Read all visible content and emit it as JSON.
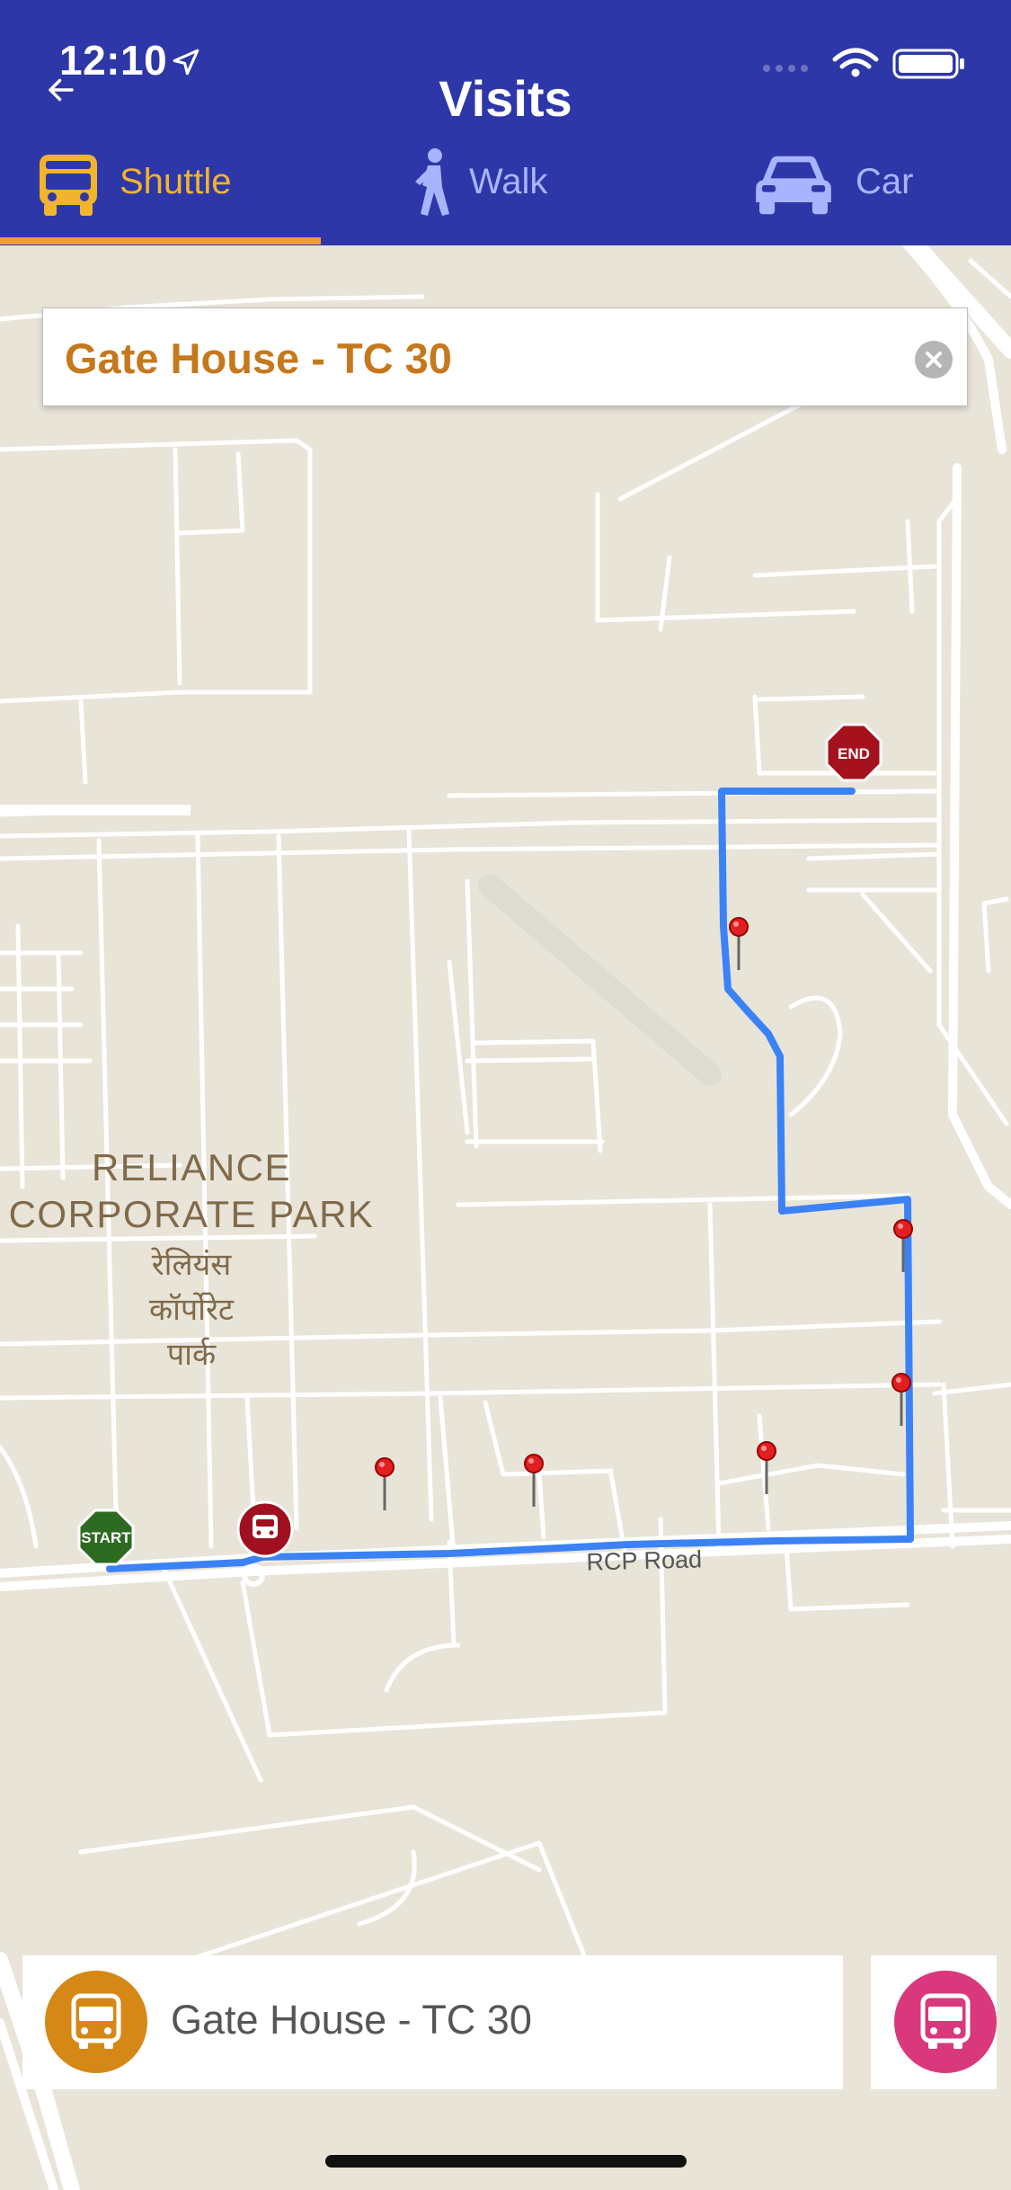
{
  "status": {
    "time": "12:10"
  },
  "header": {
    "title": "Visits"
  },
  "tabs": [
    {
      "label": "Shuttle",
      "selected": true
    },
    {
      "label": "Walk",
      "selected": false
    },
    {
      "label": "Car",
      "selected": false
    }
  ],
  "search": {
    "value": "Gate House - TC 30"
  },
  "map": {
    "area_label_en_line1": "RELIANCE",
    "area_label_en_line2": "CORPORATE PARK",
    "area_label_hi_line1": "रेलियंस",
    "area_label_hi_line2": "कॉर्पोरेट",
    "area_label_hi_line3": "पार्क",
    "road_label": "RCP Road",
    "start_label": "START",
    "end_label": "END",
    "route_color": "#3b82f6"
  },
  "bottom_card": {
    "stop_name": "Gate House - TC 30"
  },
  "colors": {
    "header_bg": "#2e37a7",
    "accent": "#f09a3c",
    "selected_tab": "#f2b42c",
    "unselected_tab": "#a9b4ff"
  },
  "icons": {
    "back": "arrow-left-icon",
    "shuttle": "bus-icon",
    "walk": "walking-person-icon",
    "car": "car-icon",
    "clear": "clear-x-icon",
    "start": "start-stop-sign-icon",
    "end": "end-stop-sign-icon",
    "pin": "map-pin-icon"
  }
}
